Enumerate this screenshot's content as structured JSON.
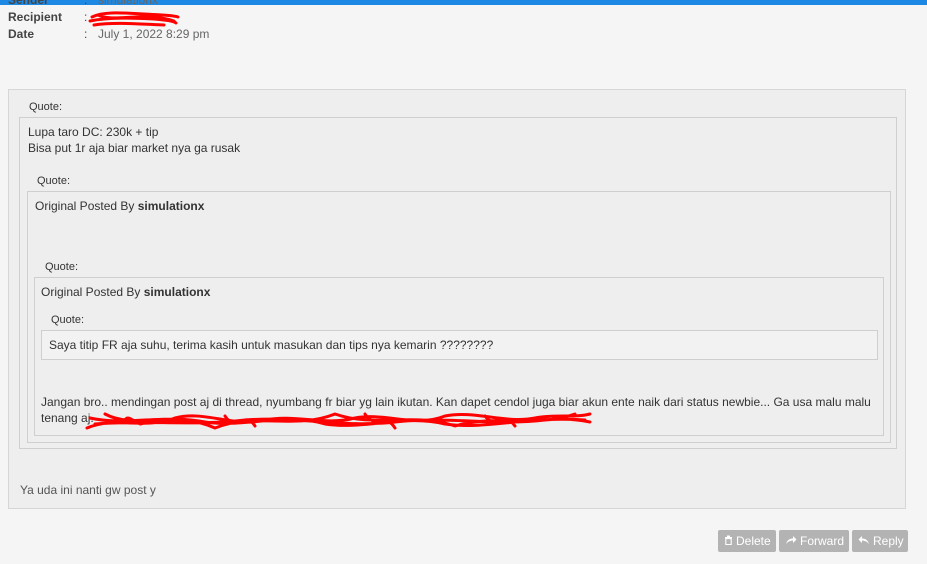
{
  "meta": {
    "sender_label": "Sender",
    "sender_value": "simulationx",
    "recipient_label": "Recipient",
    "date_label": "Date",
    "date_value": "July 1, 2022 8:29 pm",
    "colon": ":"
  },
  "quote_label": "Quote:",
  "outer_quote": {
    "line1": "Lupa taro DC: 230k + tip",
    "line2": "Bisa put 1r aja biar market nya ga rusak"
  },
  "level2": {
    "posted_prefix": "Original Posted By",
    "posted_user": "simulationx"
  },
  "level3": {
    "posted_prefix": "Original Posted By",
    "posted_user": "simulationx",
    "innermost_text": "Saya titip FR aja suhu, terima kasih untuk masukan dan tips nya kemarin ????????",
    "body_line1": "Jangan bro.. mendingan post aj di thread, nyumbang fr biar yg lain ikutan. Kan dapet cendol juga biar akun ente naik dari status newbie... Ga usa malu malu",
    "body_line2_start": "tenang aj."
  },
  "reply_text": "Ya uda ini nanti gw post y",
  "buttons": {
    "delete": "Delete",
    "forward": "Forward",
    "reply": "Reply"
  },
  "icons": {
    "delete": "trash-icon",
    "forward": "share-arrow-icon",
    "reply": "reply-arrow-icon"
  },
  "colors": {
    "topbar": "#1e88e5",
    "redaction": "#ff0000",
    "button_bg": "#b3b3b3"
  }
}
